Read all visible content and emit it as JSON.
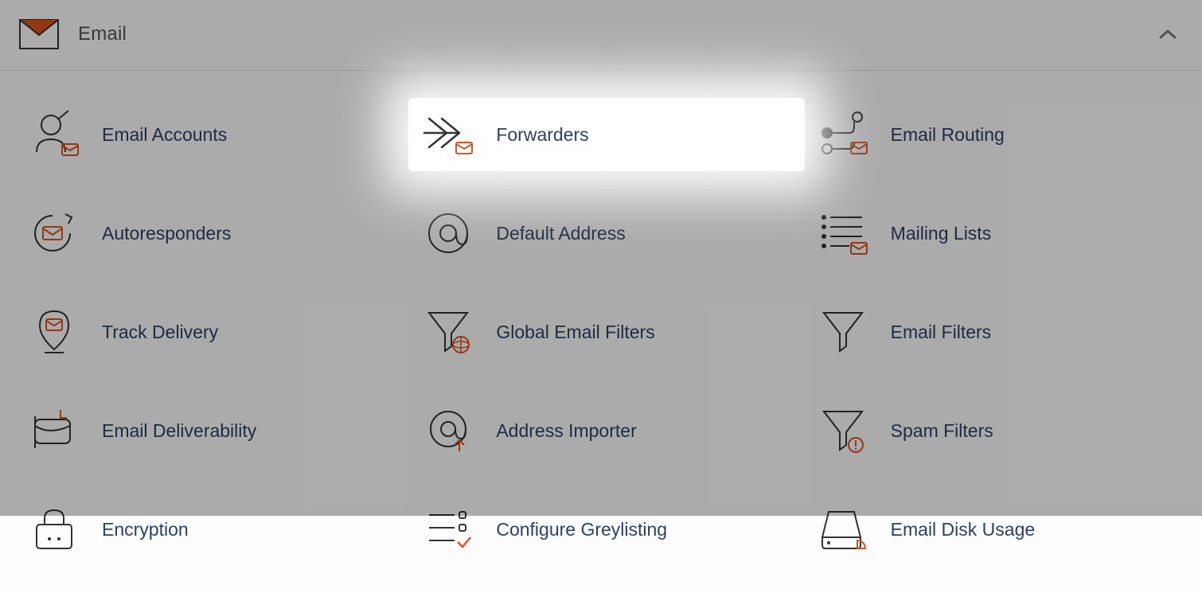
{
  "panel": {
    "title": "Email"
  },
  "items": [
    {
      "label": "Email Accounts"
    },
    {
      "label": "Forwarders"
    },
    {
      "label": "Email Routing"
    },
    {
      "label": "Autoresponders"
    },
    {
      "label": "Default Address"
    },
    {
      "label": "Mailing Lists"
    },
    {
      "label": "Track Delivery"
    },
    {
      "label": "Global Email Filters"
    },
    {
      "label": "Email Filters"
    },
    {
      "label": "Email Deliverability"
    },
    {
      "label": "Address Importer"
    },
    {
      "label": "Spam Filters"
    },
    {
      "label": "Encryption"
    },
    {
      "label": "Configure Greylisting"
    },
    {
      "label": "Email Disk Usage"
    }
  ]
}
